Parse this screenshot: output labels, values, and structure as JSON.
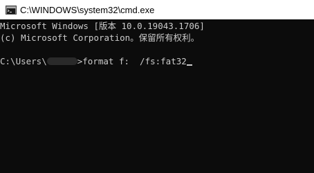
{
  "window": {
    "title": "C:\\WINDOWS\\system32\\cmd.exe",
    "icon": "cmd-icon"
  },
  "console": {
    "version_line": "Microsoft Windows [版本 10.0.19043.1706]",
    "copyright_line": "(c) Microsoft Corporation。保留所有权利。",
    "prompt_prefix": "C:\\Users\\",
    "prompt_command": ">format f:  /fs:fat32"
  },
  "colors": {
    "background": "#0c0c0c",
    "text": "#cccccc",
    "titlebar": "#ffffff"
  }
}
